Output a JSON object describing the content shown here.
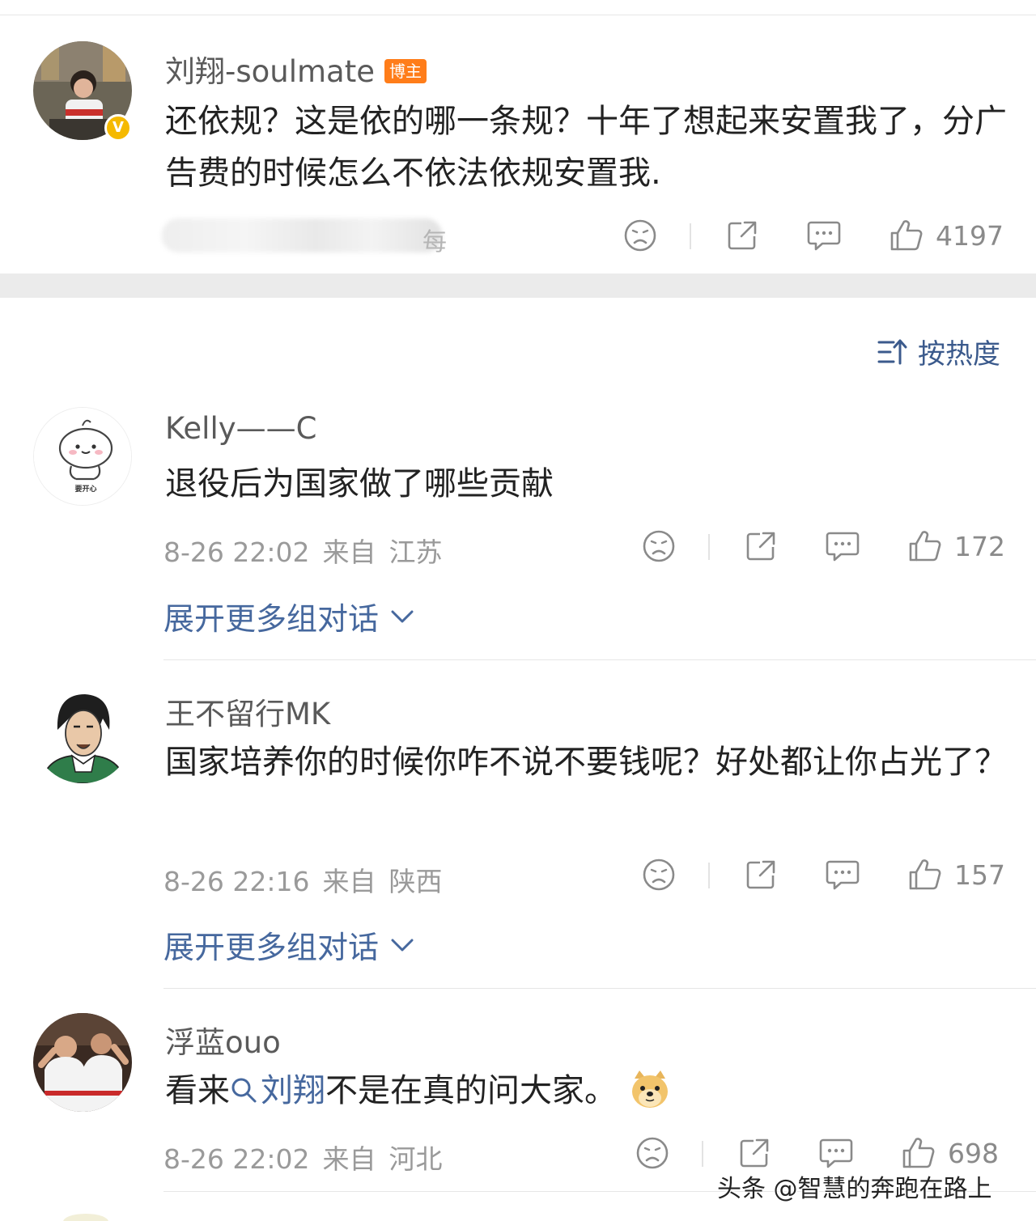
{
  "blogger": {
    "username": "刘翔-soulmate",
    "badge": "博主",
    "verified_mark": "V",
    "text": "还依规？这是依的哪一条规？十年了想起来安置我了，分广告费的时候怎么不依法依规安置我.",
    "meta_blurred": "每",
    "likes": "4197"
  },
  "sort": {
    "label": "按热度",
    "icon": "sort-icon"
  },
  "comments": [
    {
      "username": "Kelly——C",
      "text": "退役后为国家做了哪些贡献",
      "date": "8-26 22:02",
      "from_label": "来自",
      "location": "江苏",
      "likes": "172",
      "expand_label": "展开更多组对话",
      "avatar_caption": "要开心"
    },
    {
      "username": "王不留行MK",
      "text": "国家培养你的时候你咋不说不要钱呢？好处都让你占光了？",
      "date": "8-26 22:16",
      "from_label": "来自",
      "location": "陕西",
      "likes": "157",
      "expand_label": "展开更多组对话"
    },
    {
      "username": "浮蓝ouo",
      "text_before": "看来",
      "mention": "刘翔",
      "text_after": "不是在真的问大家。",
      "date": "8-26 22:02",
      "from_label": "来自",
      "location": "河北",
      "likes": "698"
    }
  ],
  "watermark": "头条 @智慧的奔跑在路上",
  "colors": {
    "link": "#46689e",
    "badge": "#ff7d1a",
    "verified": "#f5b900",
    "muted": "#9a9a9a",
    "band": "#ebebeb"
  }
}
